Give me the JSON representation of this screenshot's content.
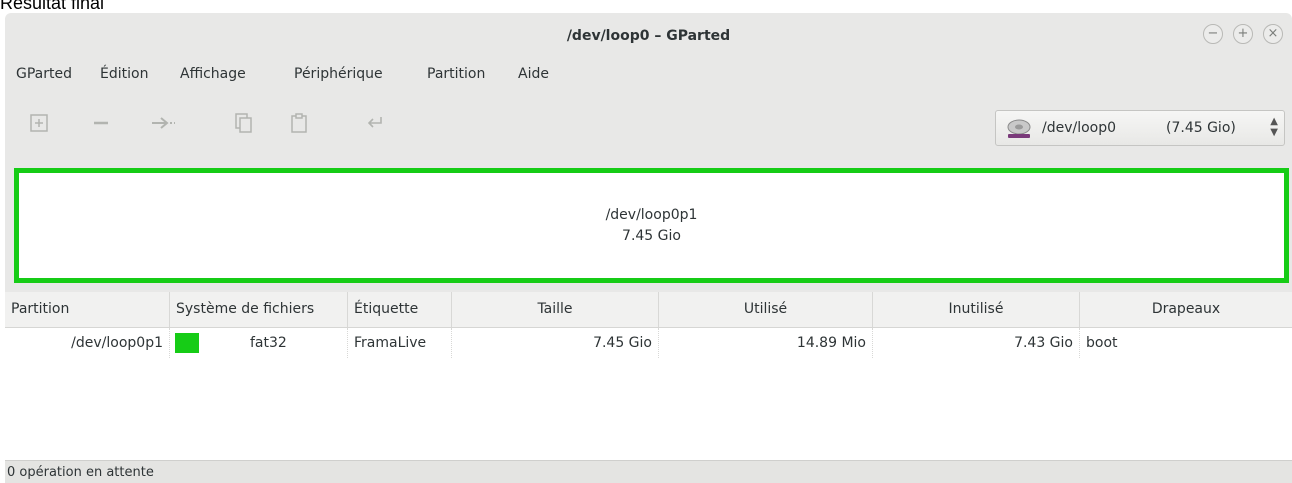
{
  "caption": "Résultat final",
  "window": {
    "title": "/dev/loop0 – GParted",
    "controls": {
      "minimize": "−",
      "maximize": "+",
      "close": "×"
    }
  },
  "menu": {
    "items": [
      "GParted",
      "Édition",
      "Affichage",
      "Périphérique",
      "Partition",
      "Aide"
    ]
  },
  "toolbar": {
    "icons": [
      "new-partition-icon",
      "delete-icon",
      "resize-move-icon",
      "copy-icon",
      "paste-icon",
      "undo-icon"
    ],
    "device": {
      "path": "/dev/loop0",
      "size": "(7.45 Gio)"
    }
  },
  "partition_map": {
    "path": "/dev/loop0p1",
    "size": "7.45 Gio",
    "color": "#16cc16"
  },
  "table": {
    "headers": [
      "Partition",
      "Système de fichiers",
      "Étiquette",
      "Taille",
      "Utilisé",
      "Inutilisé",
      "Drapeaux"
    ],
    "rows": [
      {
        "partition": "/dev/loop0p1",
        "fs": "fat32",
        "label": "FramaLive",
        "size": "7.45 Gio",
        "used": "14.89 Mio",
        "unused": "7.43 Gio",
        "flags": "boot"
      }
    ]
  },
  "status": {
    "text": "0 opération en attente"
  }
}
